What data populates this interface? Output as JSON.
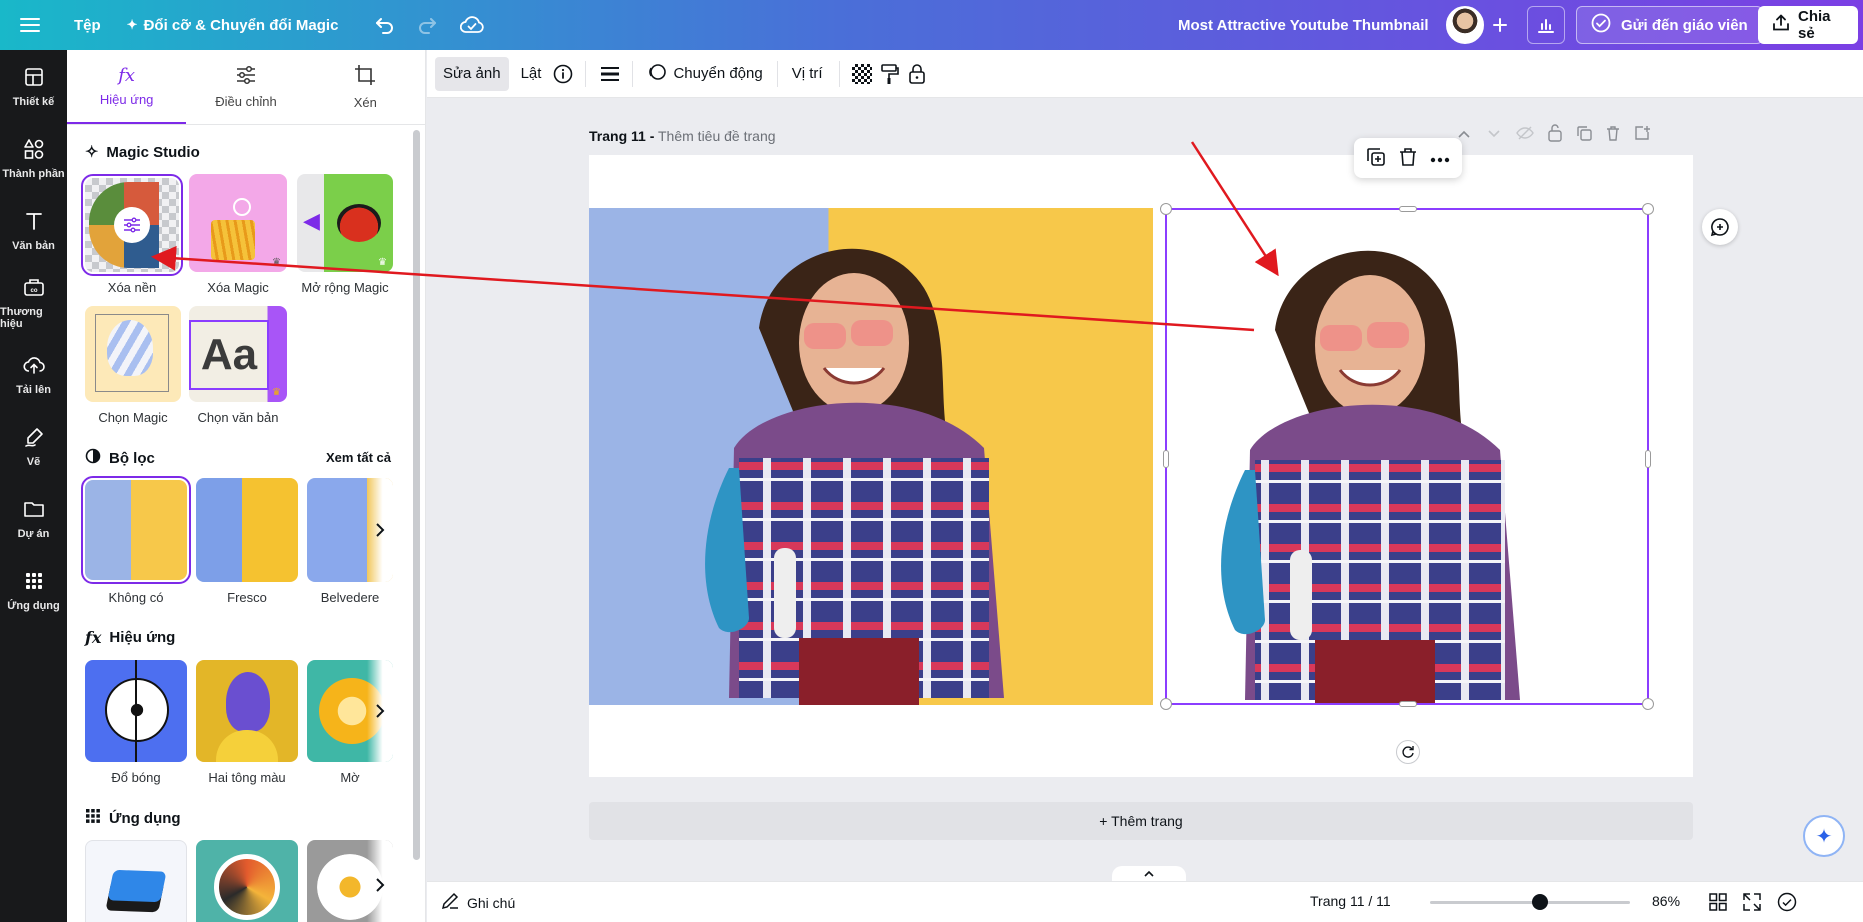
{
  "topbar": {
    "file_label": "Tệp",
    "resize_label": "Đổi cỡ & Chuyển đổi Magic",
    "doc_title": "Most Attractive Youtube Thumbnail",
    "send_label": "Gửi đến giáo viên",
    "share_label": "Chia sẻ"
  },
  "rail": [
    {
      "label": "Thiết kế",
      "icon": "layout-icon"
    },
    {
      "label": "Thành phần",
      "icon": "shapes-icon"
    },
    {
      "label": "Văn bản",
      "icon": "text-icon"
    },
    {
      "label": "Thương hiệu",
      "icon": "brand-icon"
    },
    {
      "label": "Tải lên",
      "icon": "upload-icon"
    },
    {
      "label": "Vẽ",
      "icon": "draw-icon"
    },
    {
      "label": "Dự án",
      "icon": "folder-icon"
    },
    {
      "label": "Ứng dụng",
      "icon": "apps-icon"
    }
  ],
  "panel": {
    "tabs": [
      {
        "label": "Hiệu ứng",
        "active": true
      },
      {
        "label": "Điều chỉnh",
        "active": false
      },
      {
        "label": "Xén",
        "active": false
      }
    ],
    "magic_studio": {
      "title": "Magic Studio",
      "items": [
        "Xóa nền",
        "Xóa Magic",
        "Mở rộng Magic",
        "Chọn Magic",
        "Chọn văn bản"
      ]
    },
    "filters": {
      "title": "Bộ lọc",
      "see_all": "Xem tất cả",
      "items": [
        "Không có",
        "Fresco",
        "Belvedere"
      ]
    },
    "effects": {
      "title": "Hiệu ứng",
      "items": [
        "Đổ bóng",
        "Hai tông màu",
        "Mờ"
      ]
    },
    "apps": {
      "title": "Ứng dụng"
    }
  },
  "toolbar": {
    "edit_photo": "Sửa ảnh",
    "flip": "Lật",
    "animate": "Chuyển động",
    "position": "Vị trí"
  },
  "canvas": {
    "page_label": "Trang 11 -",
    "page_title_placeholder": "Thêm tiêu đề trang",
    "add_page": "+ Thêm trang"
  },
  "bottombar": {
    "notes": "Ghi chú",
    "page_counter": "Trang 11 / 11",
    "zoom": "86%",
    "zoom_level": 0.55
  },
  "colors": {
    "accent": "#7d2ae8",
    "selection": "#8b3dff",
    "annotation_arrow": "#e0191f"
  }
}
